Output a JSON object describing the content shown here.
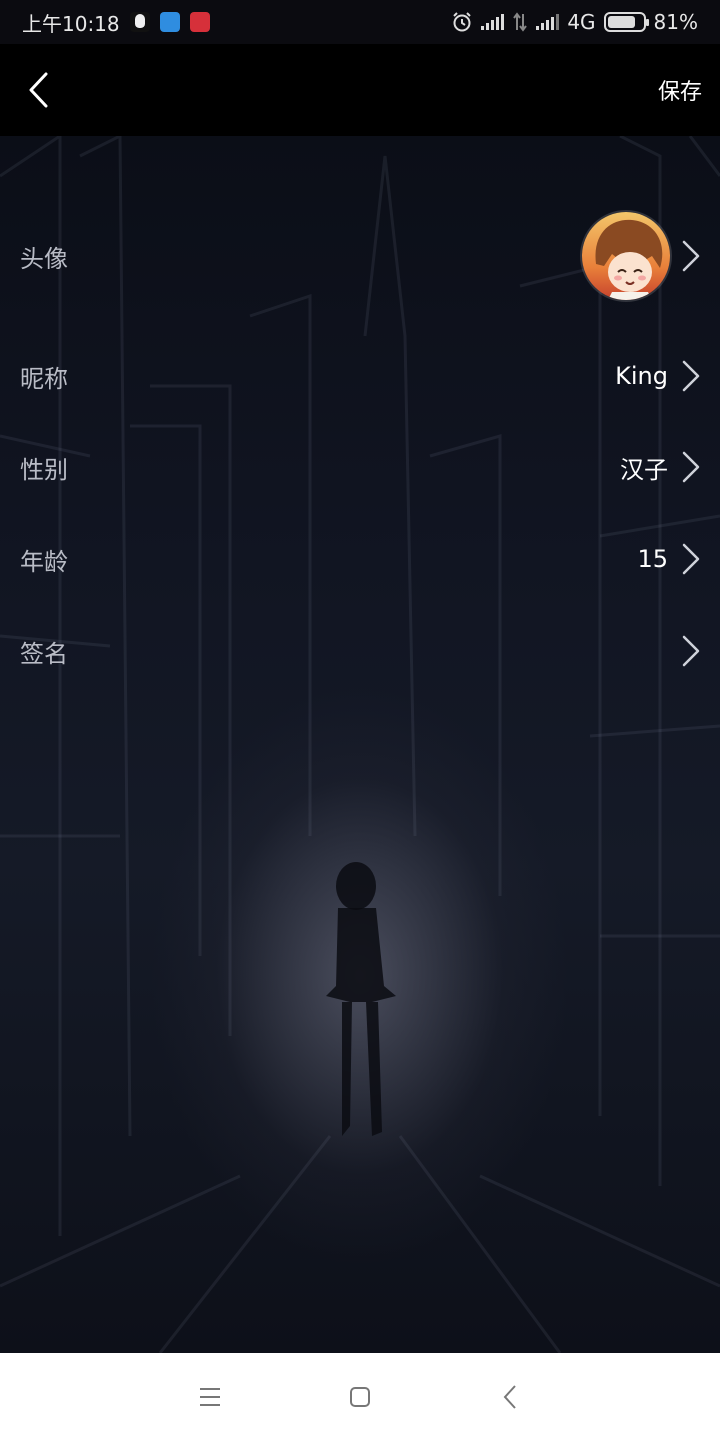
{
  "status_bar": {
    "time": "上午10:18",
    "network": "4G",
    "battery": "81%",
    "battery_level": 0.81,
    "icons": [
      "qq-icon",
      "blue-app-icon",
      "red-app-icon",
      "alarm-icon",
      "signal-icon",
      "data-arrows-icon",
      "signal-icon",
      "battery-icon"
    ]
  },
  "header": {
    "back_icon": "chevron-left-icon",
    "save_label": "保存"
  },
  "form": {
    "avatar": {
      "label": "头像"
    },
    "nickname": {
      "label": "昵称",
      "value": "King"
    },
    "gender": {
      "label": "性别",
      "value": "汉子"
    },
    "age": {
      "label": "年龄",
      "value": "15"
    },
    "signature": {
      "label": "签名",
      "value": ""
    }
  },
  "nav_bar": {
    "icons": [
      "menu-icon",
      "home-square-icon",
      "back-icon"
    ]
  },
  "colors": {
    "background_dark": "#0b0e17",
    "label_gray": "#b9bcc6",
    "nav_bg": "#ffffff"
  }
}
